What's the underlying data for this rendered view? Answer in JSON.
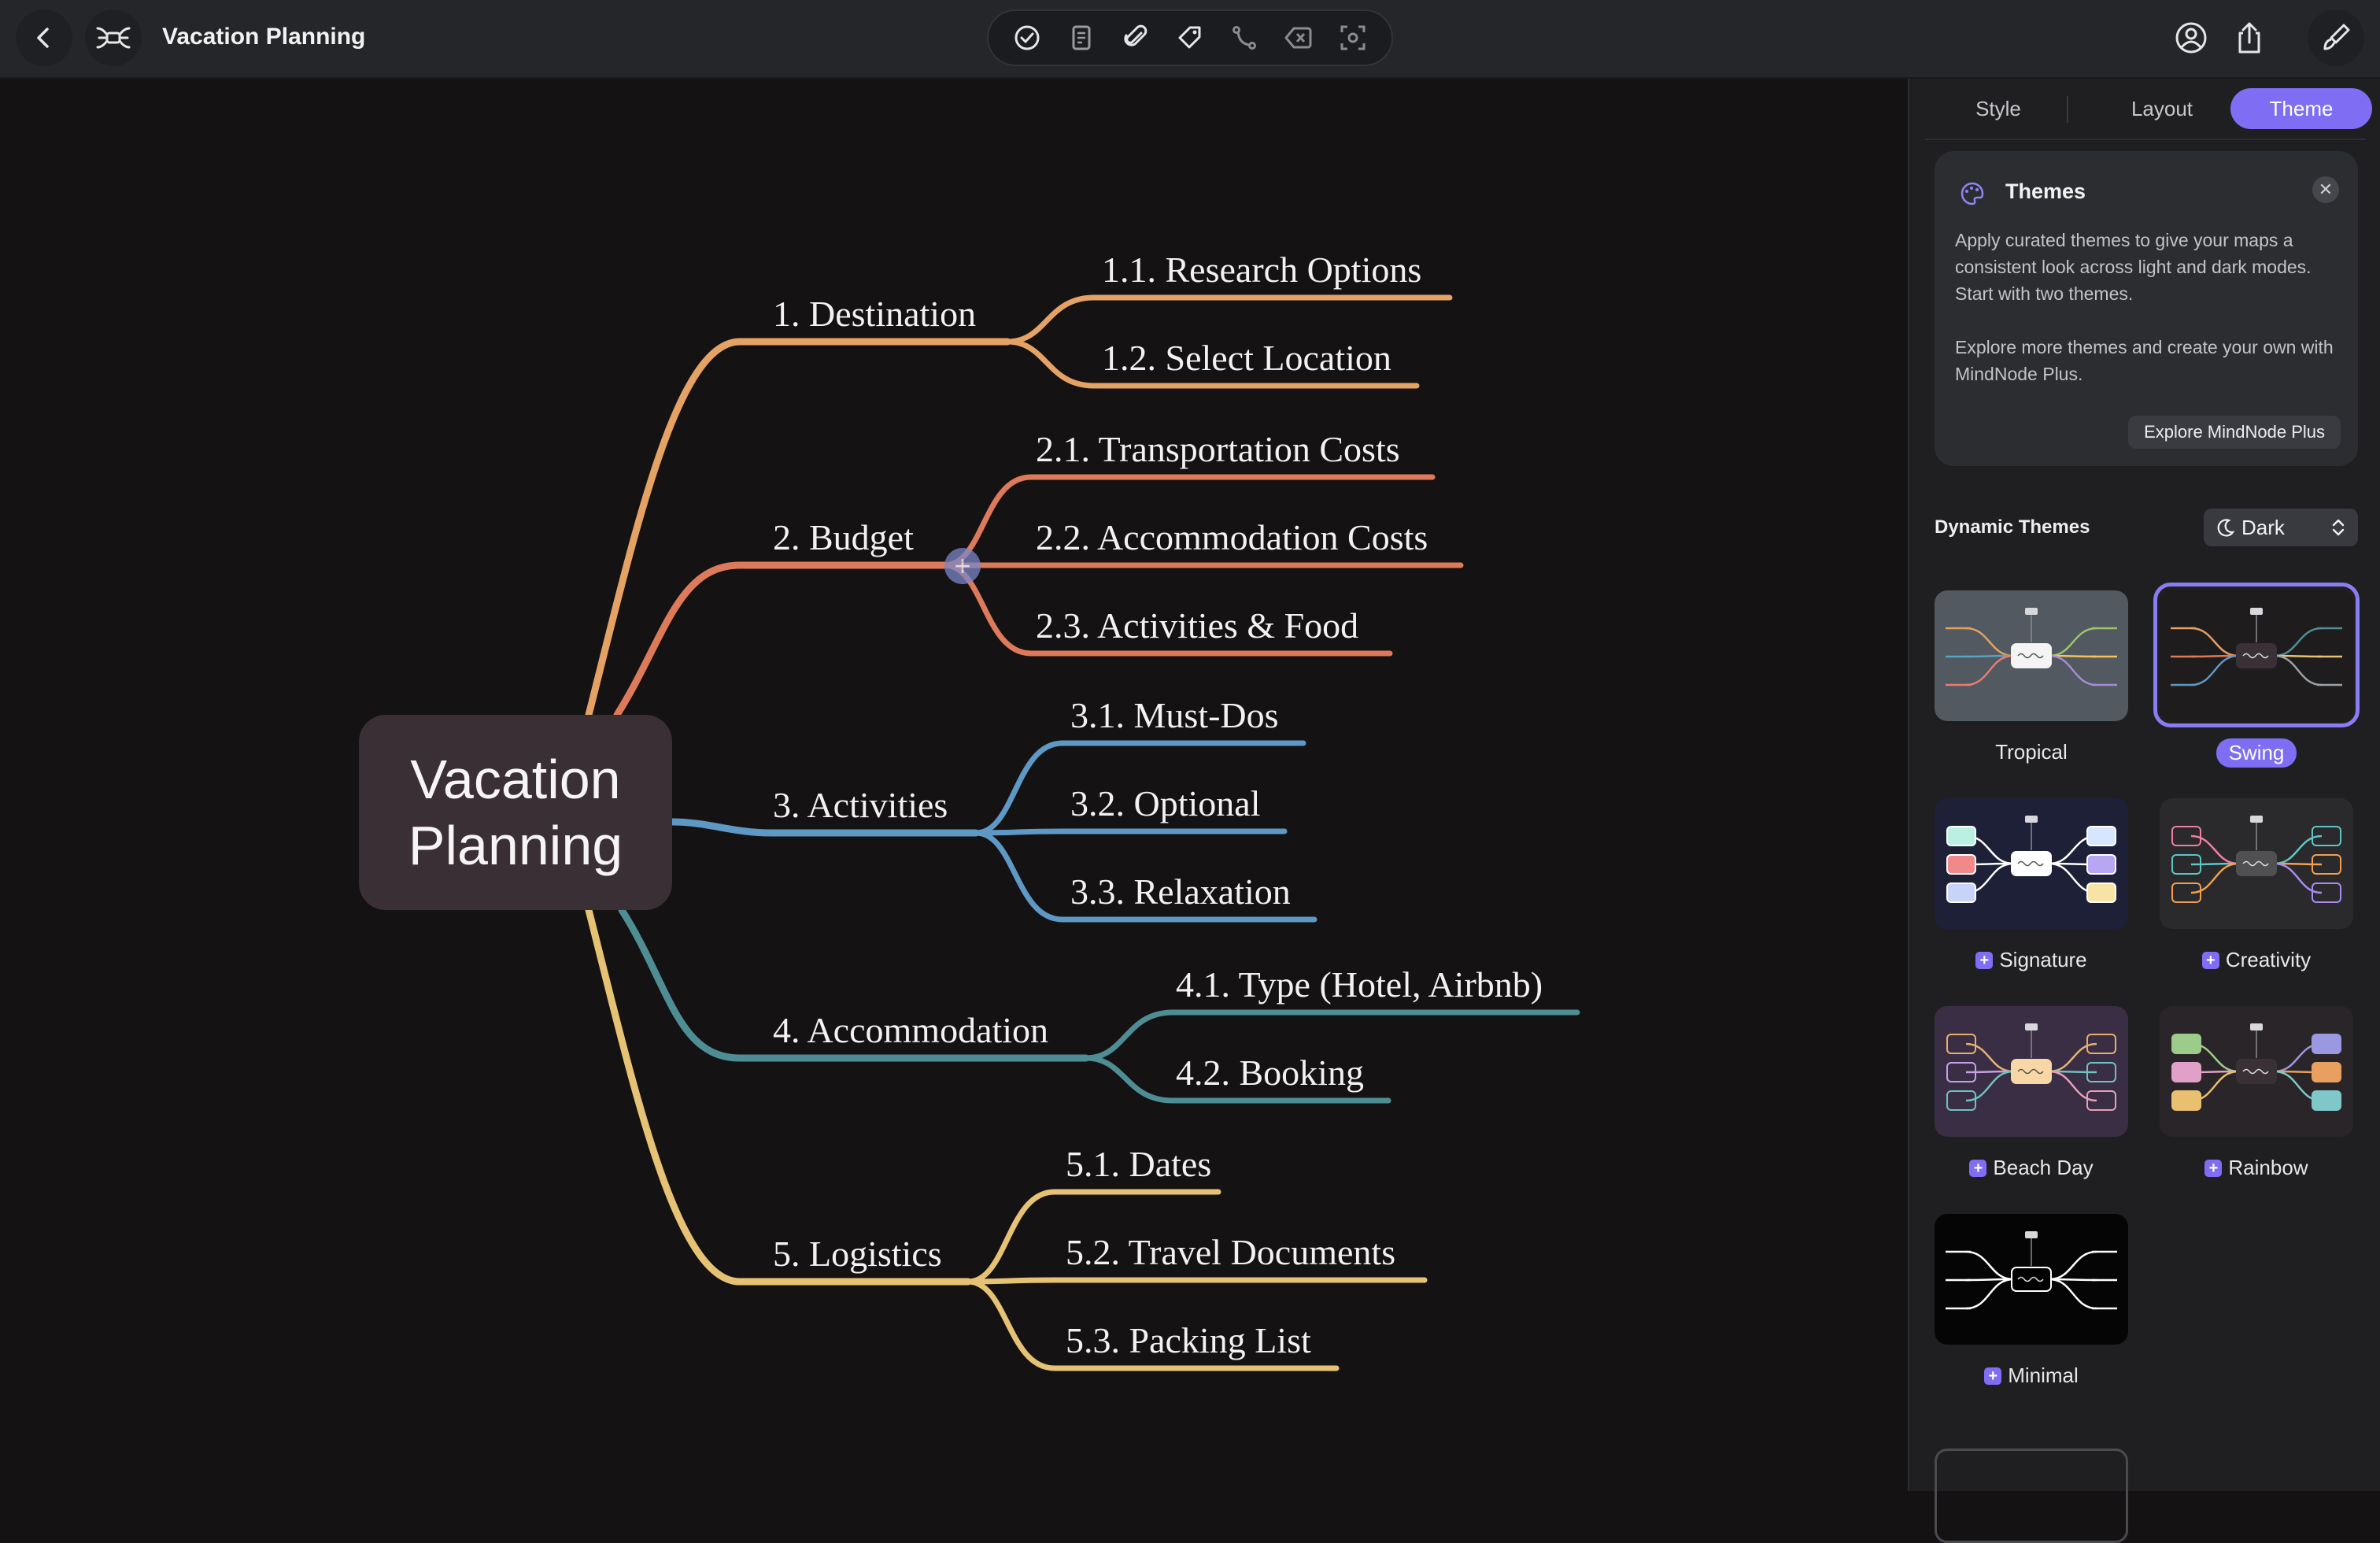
{
  "window": {
    "title": "Vacation Planning"
  },
  "toolbar": {
    "icons": [
      "checkmark-circle-icon",
      "note-icon",
      "paperclip-icon",
      "tag-icon",
      "connection-icon",
      "backspace-icon",
      "focus-icon"
    ]
  },
  "map": {
    "root": {
      "line1": "Vacation",
      "line2": "Planning"
    },
    "branches": [
      {
        "label": "1. Destination",
        "color": "#e4a264",
        "children": [
          "1.1. Research Options",
          "1.2. Select Location"
        ]
      },
      {
        "label": "2. Budget",
        "color": "#dd7a5a",
        "children": [
          "2.1. Transportation Costs",
          "2.2. Accommodation Costs",
          "2.3. Activities & Food"
        ]
      },
      {
        "label": "3. Activities",
        "color": "#5e98c4",
        "children": [
          "3.1. Must-Dos",
          "3.2. Optional",
          "3.3. Relaxation"
        ]
      },
      {
        "label": "4. Accommodation",
        "color": "#4f8d94",
        "children": [
          "4.1. Type (Hotel, Airbnb)",
          "4.2. Booking"
        ]
      },
      {
        "label": "5. Logistics",
        "color": "#e6c274",
        "children": [
          "5.1. Dates",
          "5.2. Travel Documents",
          "5.3. Packing List"
        ]
      }
    ]
  },
  "sidebar": {
    "tabs": [
      {
        "label": "Style",
        "active": false
      },
      {
        "label": "Layout",
        "active": false
      },
      {
        "label": "Theme",
        "active": true
      }
    ],
    "themes_card": {
      "title": "Themes",
      "para1": "Apply curated themes to give your maps a consistent look across light and dark modes. Start with two themes.",
      "para2": "Explore more themes and create your own with MindNode Plus.",
      "button": "Explore MindNode Plus"
    },
    "dynamic_themes": {
      "title": "Dynamic Themes",
      "mode": "Dark",
      "items": [
        {
          "name": "Tropical",
          "selected": false,
          "plus": false
        },
        {
          "name": "Swing",
          "selected": true,
          "plus": false
        },
        {
          "name": "Signature",
          "selected": false,
          "plus": true
        },
        {
          "name": "Creativity",
          "selected": false,
          "plus": true
        },
        {
          "name": "Beach Day",
          "selected": false,
          "plus": true
        },
        {
          "name": "Rainbow",
          "selected": false,
          "plus": true
        },
        {
          "name": "Minimal",
          "selected": false,
          "plus": true
        }
      ]
    }
  }
}
